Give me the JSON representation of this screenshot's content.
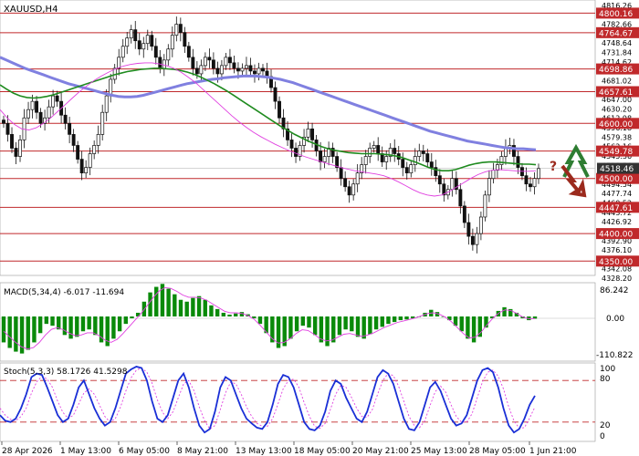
{
  "symbol_label": "XAUUSD,H4",
  "price_axis": {
    "ticks": [
      "4816.26",
      "4799.46",
      "4782.66",
      "4765.44",
      "4748.64",
      "4731.84",
      "4714.62",
      "4697.82",
      "4681.02",
      "4663.80",
      "4647.00",
      "4630.20",
      "4612.98",
      "4596.18",
      "4579.38",
      "4562.16",
      "4545.36",
      "4528.56",
      "4511.34",
      "4494.54",
      "4477.74",
      "4460.52",
      "4443.72",
      "4426.92",
      "4409.70",
      "4392.90",
      "4376.10",
      "4358.88",
      "4342.08",
      "4328.20"
    ],
    "ylim": [
      4324.0,
      4824.0
    ]
  },
  "levels": [
    {
      "value": 4800.16,
      "label": "4800.16"
    },
    {
      "value": 4764.67,
      "label": "4764.67"
    },
    {
      "value": 4698.86,
      "label": "4698.86"
    },
    {
      "value": 4657.61,
      "label": "4657.61"
    },
    {
      "value": 4600.0,
      "label": "4600.00"
    },
    {
      "value": 4549.78,
      "label": "4549.78"
    },
    {
      "value": 4500.0,
      "label": "4500.00"
    },
    {
      "value": 4447.61,
      "label": "4447.61"
    },
    {
      "value": 4400.0,
      "label": "4400.00"
    },
    {
      "value": 4350.0,
      "label": "4350.00"
    }
  ],
  "current_price": {
    "value": 4518.46,
    "label": "4518.46"
  },
  "scenario_marks": {
    "question": "?",
    "up_arrow_icon": "up-arrow-icon",
    "down_arrow_icon": "down-arrow-icon"
  },
  "macd": {
    "label": "MACD(5,34,4) -6.017 -11.694",
    "axis_ticks": [
      "86.242",
      "0.00",
      "-110.822"
    ],
    "ylim": [
      -110.822,
      86.242
    ]
  },
  "stoch": {
    "label": "Stoch(5,3,3) 58.1726 41.5298",
    "axis_ticks": [
      "100",
      "80",
      "20",
      "0"
    ],
    "levels": [
      80,
      20
    ]
  },
  "x_axis_labels": [
    "28 Apr 2026",
    "1 May 13:00",
    "6 May 05:00",
    "8 May 21:00",
    "13 May 13:00",
    "18 May 05:00",
    "20 May 21:00",
    "25 May 13:00",
    "28 May 05:00",
    "1 Jun 21:00"
  ],
  "colors": {
    "level_line": "#c0292b",
    "level_label_bg": "#c0292b",
    "ma_slow": "#8080e0",
    "ma_mid": "#1f8b1f",
    "ma_fast": "#e040e0",
    "macd_hist": "#0a8a0a",
    "macd_signal": "#e040e0",
    "stoch_main": "#1a2fd6",
    "stoch_signal": "#e040e0",
    "arrow_up": "#2e7d32",
    "arrow_down": "#9b2a1d",
    "candle": "#111111"
  },
  "chart_data": {
    "type": "candlestick",
    "series": [
      {
        "name": "XAUUSD,H4",
        "close": [
          4600,
          4580,
          4555,
          4540,
          4570,
          4610,
          4625,
          4640,
          4620,
          4600,
          4610,
          4630,
          4650,
          4640,
          4615,
          4600,
          4580,
          4560,
          4535,
          4510,
          4520,
          4545,
          4560,
          4580,
          4620,
          4650,
          4680,
          4700,
          4720,
          4740,
          4755,
          4770,
          4750,
          4735,
          4745,
          4760,
          4740,
          4720,
          4700,
          4715,
          4735,
          4760,
          4780,
          4765,
          4740,
          4720,
          4700,
          4690,
          4705,
          4720,
          4715,
          4700,
          4690,
          4705,
          4720,
          4710,
          4700,
          4695,
          4700,
          4705,
          4695,
          4690,
          4700,
          4695,
          4685,
          4665,
          4640,
          4610,
          4590,
          4570,
          4555,
          4540,
          4560,
          4575,
          4590,
          4570,
          4550,
          4530,
          4540,
          4555,
          4540,
          4520,
          4500,
          4485,
          4470,
          4490,
          4510,
          4525,
          4540,
          4555,
          4560,
          4545,
          4530,
          4540,
          4555,
          4545,
          4535,
          4520,
          4510,
          4525,
          4540,
          4550,
          4545,
          4530,
          4520,
          4505,
          4490,
          4470,
          4480,
          4500,
          4480,
          4450,
          4420,
          4395,
          4380,
          4400,
          4430,
          4470,
          4500,
          4515,
          4525,
          4540,
          4555,
          4560,
          4540,
          4520,
          4505,
          4490,
          4485,
          4500,
          4518
        ]
      },
      {
        "name": "MA slow",
        "values": [
          4720,
          4715,
          4710,
          4705,
          4700,
          4696,
          4692,
          4688,
          4684,
          4680,
          4676,
          4672,
          4669,
          4666,
          4663,
          4660,
          4657,
          4654,
          4651,
          4649,
          4648,
          4648,
          4649,
          4651,
          4654,
          4657,
          4660,
          4663,
          4666,
          4669,
          4672,
          4674,
          4676,
          4678,
          4680,
          4681,
          4683,
          4684,
          4685,
          4686,
          4686,
          4686,
          4685,
          4684,
          4682,
          4680,
          4677,
          4674,
          4670,
          4666,
          4662,
          4658,
          4654,
          4650,
          4646,
          4642,
          4638,
          4634,
          4630,
          4626,
          4622,
          4618,
          4614,
          4610,
          4606,
          4602,
          4598,
          4594,
          4590,
          4586,
          4583,
          4580,
          4577,
          4574,
          4571,
          4568,
          4566,
          4564,
          4562,
          4560,
          4558,
          4556,
          4555,
          4554,
          4554,
          4553,
          4552
        ]
      },
      {
        "name": "MA mid",
        "values": [
          4670,
          4662,
          4655,
          4650,
          4647,
          4646,
          4647,
          4649,
          4652,
          4656,
          4660,
          4664,
          4668,
          4672,
          4676,
          4680,
          4684,
          4688,
          4691,
          4694,
          4696,
          4698,
          4699,
          4700,
          4700,
          4699,
          4698,
          4696,
          4693,
          4689,
          4684,
          4678,
          4672,
          4665,
          4658,
          4650,
          4642,
          4634,
          4626,
          4618,
          4610,
          4602,
          4594,
          4587,
          4580,
          4574,
          4568,
          4563,
          4558,
          4554,
          4551,
          4549,
          4547,
          4546,
          4545,
          4545,
          4545,
          4544,
          4543,
          4541,
          4538,
          4534,
          4530,
          4525,
          4520,
          4516,
          4514,
          4514,
          4516,
          4520,
          4524,
          4527,
          4529,
          4530,
          4530,
          4529,
          4528,
          4527,
          4526,
          4526,
          4525
        ]
      },
      {
        "name": "MA fast",
        "values": [
          4625,
          4610,
          4598,
          4590,
          4588,
          4592,
          4600,
          4610,
          4622,
          4634,
          4646,
          4658,
          4668,
          4678,
          4686,
          4693,
          4699,
          4704,
          4707,
          4709,
          4710,
          4710,
          4708,
          4705,
          4700,
          4693,
          4684,
          4674,
          4662,
          4650,
          4638,
          4626,
          4614,
          4603,
          4593,
          4584,
          4576,
          4569,
          4562,
          4556,
          4550,
          4545,
          4540,
          4536,
          4532,
          4528,
          4524,
          4520,
          4517,
          4514,
          4512,
          4510,
          4508,
          4505,
          4500,
          4494,
          4487,
          4480,
          4474,
          4470,
          4468,
          4470,
          4476,
          4484,
          4492,
          4500,
          4507,
          4512,
          4515,
          4516,
          4515,
          4514,
          4513,
          4513,
          4514
        ]
      },
      {
        "name": "MACD(5,34,4) histogram",
        "values": [
          -70,
          -85,
          -95,
          -100,
          -90,
          -70,
          -45,
          -20,
          -25,
          -35,
          -50,
          -60,
          -55,
          -40,
          -35,
          -50,
          -70,
          -80,
          -60,
          -40,
          -20,
          -5,
          10,
          40,
          65,
          80,
          88,
          75,
          60,
          45,
          40,
          50,
          55,
          45,
          30,
          20,
          10,
          5,
          8,
          12,
          6,
          -5,
          -20,
          -45,
          -70,
          -85,
          -80,
          -60,
          -40,
          -25,
          -30,
          -50,
          -70,
          -80,
          -70,
          -50,
          -35,
          -40,
          -55,
          -60,
          -48,
          -35,
          -28,
          -20,
          -15,
          -10,
          -8,
          -5,
          0,
          10,
          18,
          12,
          0,
          -10,
          -25,
          -40,
          -60,
          -70,
          -55,
          -30,
          -5,
          15,
          25,
          20,
          10,
          -5,
          -10,
          -6
        ]
      },
      {
        "name": "MACD(5,34,4) signal",
        "values": [
          -40,
          -55,
          -70,
          -82,
          -88,
          -84,
          -70,
          -50,
          -35,
          -30,
          -36,
          -45,
          -52,
          -50,
          -44,
          -44,
          -52,
          -64,
          -70,
          -62,
          -46,
          -28,
          -10,
          8,
          28,
          50,
          68,
          78,
          76,
          68,
          58,
          52,
          52,
          50,
          44,
          34,
          24,
          14,
          10,
          10,
          8,
          2,
          -8,
          -24,
          -42,
          -60,
          -72,
          -70,
          -60,
          -46,
          -36,
          -38,
          -48,
          -60,
          -66,
          -64,
          -56,
          -48,
          -46,
          -50,
          -54,
          -50,
          -44,
          -36,
          -28,
          -22,
          -16,
          -12,
          -8,
          -4,
          2,
          8,
          10,
          6,
          -2,
          -14,
          -30,
          -46,
          -58,
          -56,
          -42,
          -22,
          -4,
          10,
          18,
          16,
          8,
          -2,
          -6,
          -6
        ]
      },
      {
        "name": "Stoch(5,3,3) main",
        "values": [
          30,
          22,
          20,
          25,
          40,
          60,
          85,
          90,
          88,
          70,
          50,
          30,
          20,
          25,
          45,
          70,
          80,
          60,
          40,
          25,
          15,
          20,
          40,
          65,
          90,
          96,
          100,
          98,
          80,
          50,
          25,
          20,
          30,
          55,
          80,
          90,
          70,
          40,
          15,
          5,
          10,
          35,
          70,
          85,
          80,
          60,
          40,
          25,
          18,
          12,
          10,
          20,
          45,
          75,
          88,
          85,
          70,
          45,
          20,
          10,
          8,
          15,
          35,
          65,
          80,
          75,
          55,
          40,
          25,
          20,
          35,
          60,
          85,
          95,
          90,
          75,
          50,
          25,
          10,
          8,
          20,
          45,
          70,
          78,
          65,
          45,
          25,
          15,
          18,
          30,
          55,
          80,
          95,
          98,
          92,
          70,
          40,
          15,
          5,
          10,
          25,
          45,
          58
        ]
      },
      {
        "name": "Stoch(5,3,3) signal",
        "values": [
          40,
          30,
          24,
          22,
          28,
          40,
          62,
          78,
          86,
          82,
          70,
          50,
          34,
          25,
          30,
          46,
          62,
          68,
          60,
          44,
          28,
          20,
          25,
          42,
          65,
          84,
          95,
          98,
          92,
          76,
          52,
          34,
          25,
          35,
          55,
          75,
          80,
          65,
          42,
          22,
          10,
          15,
          38,
          62,
          78,
          75,
          60,
          42,
          28,
          18,
          14,
          14,
          25,
          46,
          68,
          80,
          82,
          70,
          48,
          28,
          14,
          11,
          18,
          38,
          60,
          73,
          70,
          56,
          40,
          28,
          27,
          38,
          60,
          80,
          90,
          87,
          72,
          50,
          28,
          15,
          12,
          22,
          44,
          64,
          72,
          63,
          45,
          28,
          20,
          20,
          32,
          55,
          78,
          92,
          95,
          86,
          68,
          42,
          22,
          11,
          12,
          26,
          42
        ]
      }
    ],
    "ylim": [
      4324.0,
      4824.0
    ],
    "levels": [
      4800.16,
      4764.67,
      4698.86,
      4657.61,
      4600.0,
      4549.78,
      4500.0,
      4447.61,
      4400.0,
      4350.0
    ]
  }
}
